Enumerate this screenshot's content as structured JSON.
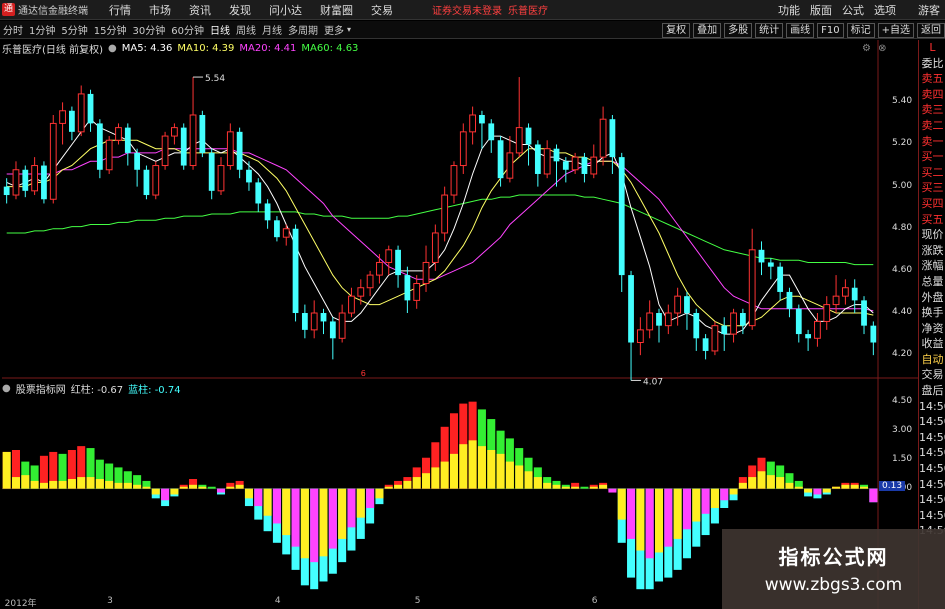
{
  "app": {
    "logo_glyph": "通",
    "title": "通达信金融终端"
  },
  "menu": [
    "行情",
    "市场",
    "资讯",
    "发现",
    "问小达",
    "财富圈",
    "交易"
  ],
  "login_notice": "证券交易未登录",
  "stock_link": "乐普医疗",
  "right_menu": [
    "功能",
    "版面",
    "公式",
    "选项",
    "游客"
  ],
  "periods": [
    "分时",
    "1分钟",
    "5分钟",
    "15分钟",
    "30分钟",
    "60分钟",
    "日线",
    "周线",
    "月线",
    "多周期",
    "更多"
  ],
  "active_period": "日线",
  "toolbar_buttons": [
    "复权",
    "叠加",
    "多股",
    "统计",
    "画线",
    "F10",
    "标记",
    "+自选",
    "返回"
  ],
  "main_legend": {
    "title": "乐普医疗(日线 前复权)",
    "items": [
      {
        "label": "MA5: 4.36",
        "color": "#ffffff"
      },
      {
        "label": "MA10: 4.39",
        "color": "#ffff66"
      },
      {
        "label": "MA20: 4.41",
        "color": "#ff44ff"
      },
      {
        "label": "MA60: 4.63",
        "color": "#44ff44"
      }
    ]
  },
  "sub_legend": {
    "title": "股票指标网",
    "items": [
      {
        "label": "红柱: -0.67",
        "color": "#dddddd"
      },
      {
        "label": "蓝柱: -0.74",
        "color": "#44ffff"
      }
    ]
  },
  "price_labels": [
    "5.40",
    "5.20",
    "5.00",
    "4.80",
    "4.60",
    "4.40",
    "4.20"
  ],
  "indicator_labels": [
    "4.50",
    "3.00",
    "1.50",
    "0.00"
  ],
  "indicator_current": "0.13",
  "annotations": {
    "high": "5.54",
    "low": "4.07",
    "marker": "6"
  },
  "xaxis_labels": [
    {
      "text": "2012年",
      "day": 0
    },
    {
      "text": "3",
      "day": 11
    },
    {
      "text": "4",
      "day": 29
    },
    {
      "text": "5",
      "day": 44
    },
    {
      "text": "6",
      "day": 63
    }
  ],
  "sidebar": [
    {
      "t": "L",
      "c": "red"
    },
    {
      "t": "委比",
      "c": "white"
    },
    {
      "t": "卖五",
      "c": "red"
    },
    {
      "t": "卖四",
      "c": "red"
    },
    {
      "t": "卖三",
      "c": "red"
    },
    {
      "t": "卖二",
      "c": "red"
    },
    {
      "t": "卖一",
      "c": "red"
    },
    {
      "t": "买一",
      "c": "red"
    },
    {
      "t": "买二",
      "c": "red"
    },
    {
      "t": "买三",
      "c": "red"
    },
    {
      "t": "买四",
      "c": "red"
    },
    {
      "t": "买五",
      "c": "red"
    },
    {
      "t": "现价",
      "c": "white"
    },
    {
      "t": "涨跌",
      "c": "white"
    },
    {
      "t": "涨幅",
      "c": "white"
    },
    {
      "t": "总量",
      "c": "white"
    },
    {
      "t": "外盘",
      "c": "white"
    },
    {
      "t": "换手",
      "c": "white"
    },
    {
      "t": "净资",
      "c": "white"
    },
    {
      "t": "收益",
      "c": "white"
    },
    {
      "t": "自动",
      "c": "gold"
    },
    {
      "t": "交易",
      "c": "white"
    },
    {
      "t": "盘后",
      "c": "white"
    },
    {
      "t": "14:50",
      "c": "white"
    },
    {
      "t": "14:50",
      "c": "white"
    },
    {
      "t": "14:50",
      "c": "white"
    },
    {
      "t": "14:50",
      "c": "white"
    },
    {
      "t": "14:50",
      "c": "white"
    },
    {
      "t": "14:50",
      "c": "white"
    },
    {
      "t": "14:50",
      "c": "white"
    },
    {
      "t": "14:50",
      "c": "white"
    },
    {
      "t": "14:50",
      "c": "white"
    }
  ],
  "watermark": {
    "title": "指标公式网",
    "url": "www.zbgs3.com"
  },
  "colors": {
    "up": "#ff3333",
    "down": "#44ffff",
    "ma5": "#ffffff",
    "ma10": "#ffff66",
    "ma20": "#ff44ff",
    "ma60": "#44ff44",
    "bar_red": "#ff2222",
    "bar_green": "#33ee33",
    "bar_yellow": "#ffee22",
    "bar_cyan": "#44ffff",
    "bar_magenta": "#ff44ff"
  },
  "chart_data": {
    "type": "candlestick",
    "symbol": "乐普医疗",
    "ylim": [
      4.12,
      5.62
    ],
    "candles": [
      [
        5.0,
        4.96,
        5.04,
        4.92
      ],
      [
        4.96,
        5.08,
        5.12,
        4.94
      ],
      [
        5.08,
        4.98,
        5.1,
        4.95
      ],
      [
        4.98,
        5.1,
        5.14,
        4.96
      ],
      [
        5.1,
        4.94,
        5.12,
        4.92
      ],
      [
        4.94,
        5.3,
        5.34,
        4.92
      ],
      [
        5.3,
        5.36,
        5.4,
        5.2
      ],
      [
        5.36,
        5.26,
        5.38,
        5.22
      ],
      [
        5.26,
        5.44,
        5.48,
        5.24
      ],
      [
        5.44,
        5.3,
        5.46,
        5.26
      ],
      [
        5.3,
        5.08,
        5.32,
        5.04
      ],
      [
        5.08,
        5.22,
        5.24,
        5.06
      ],
      [
        5.22,
        5.28,
        5.3,
        5.2
      ],
      [
        5.28,
        5.16,
        5.3,
        5.1
      ],
      [
        5.16,
        5.08,
        5.18,
        5.0
      ],
      [
        5.08,
        4.96,
        5.1,
        4.94
      ],
      [
        4.96,
        5.1,
        5.12,
        4.94
      ],
      [
        5.1,
        5.24,
        5.26,
        5.08
      ],
      [
        5.24,
        5.28,
        5.3,
        5.2
      ],
      [
        5.28,
        5.1,
        5.3,
        5.08
      ],
      [
        5.1,
        5.34,
        5.52,
        5.08
      ],
      [
        5.34,
        5.16,
        5.36,
        5.14
      ],
      [
        5.16,
        4.98,
        5.18,
        4.94
      ],
      [
        4.98,
        5.1,
        5.14,
        4.96
      ],
      [
        5.1,
        5.26,
        5.3,
        5.08
      ],
      [
        5.26,
        5.08,
        5.28,
        5.04
      ],
      [
        5.08,
        5.02,
        5.12,
        4.98
      ],
      [
        5.02,
        4.92,
        5.04,
        4.88
      ],
      [
        4.92,
        4.84,
        4.94,
        4.8
      ],
      [
        4.84,
        4.76,
        4.86,
        4.74
      ],
      [
        4.76,
        4.8,
        4.82,
        4.72
      ],
      [
        4.8,
        4.4,
        4.82,
        4.36
      ],
      [
        4.4,
        4.32,
        4.44,
        4.28
      ],
      [
        4.32,
        4.4,
        4.46,
        4.28
      ],
      [
        4.4,
        4.36,
        4.42,
        4.3
      ],
      [
        4.36,
        4.28,
        4.38,
        4.18
      ],
      [
        4.28,
        4.4,
        4.44,
        4.26
      ],
      [
        4.4,
        4.48,
        4.52,
        4.38
      ],
      [
        4.48,
        4.52,
        4.56,
        4.44
      ],
      [
        4.52,
        4.58,
        4.6,
        4.48
      ],
      [
        4.58,
        4.64,
        4.68,
        4.54
      ],
      [
        4.64,
        4.7,
        4.72,
        4.58
      ],
      [
        4.7,
        4.58,
        4.72,
        4.52
      ],
      [
        4.58,
        4.46,
        4.62,
        4.4
      ],
      [
        4.46,
        4.54,
        4.58,
        4.42
      ],
      [
        4.54,
        4.64,
        4.72,
        4.5
      ],
      [
        4.64,
        4.78,
        4.82,
        4.6
      ],
      [
        4.78,
        4.96,
        5.0,
        4.74
      ],
      [
        4.96,
        5.1,
        5.12,
        4.92
      ],
      [
        5.1,
        5.26,
        5.3,
        5.06
      ],
      [
        5.26,
        5.34,
        5.38,
        5.2
      ],
      [
        5.34,
        5.3,
        5.36,
        5.18
      ],
      [
        5.3,
        5.22,
        5.32,
        5.16
      ],
      [
        5.22,
        5.04,
        5.24,
        5.0
      ],
      [
        5.04,
        5.16,
        5.24,
        5.02
      ],
      [
        5.16,
        5.28,
        5.52,
        5.14
      ],
      [
        5.28,
        5.2,
        5.3,
        5.1
      ],
      [
        5.2,
        5.06,
        5.22,
        5.0
      ],
      [
        5.06,
        5.18,
        5.22,
        5.04
      ],
      [
        5.18,
        5.12,
        5.2,
        5.0
      ],
      [
        5.12,
        5.08,
        5.14,
        5.02
      ],
      [
        5.08,
        5.14,
        5.16,
        5.06
      ],
      [
        5.14,
        5.06,
        5.16,
        5.02
      ],
      [
        5.06,
        5.14,
        5.2,
        5.04
      ],
      [
        5.14,
        5.32,
        5.38,
        5.1
      ],
      [
        5.32,
        5.14,
        5.34,
        5.06
      ],
      [
        5.14,
        4.58,
        5.16,
        4.5
      ],
      [
        4.58,
        4.26,
        4.6,
        4.08
      ],
      [
        4.26,
        4.32,
        4.38,
        4.2
      ],
      [
        4.32,
        4.4,
        4.46,
        4.28
      ],
      [
        4.4,
        4.34,
        4.42,
        4.26
      ],
      [
        4.34,
        4.4,
        4.44,
        4.3
      ],
      [
        4.4,
        4.48,
        4.52,
        4.34
      ],
      [
        4.48,
        4.4,
        4.5,
        4.32
      ],
      [
        4.4,
        4.28,
        4.42,
        4.22
      ],
      [
        4.28,
        4.22,
        4.3,
        4.18
      ],
      [
        4.22,
        4.34,
        4.36,
        4.2
      ],
      [
        4.34,
        4.3,
        4.38,
        4.22
      ],
      [
        4.3,
        4.4,
        4.42,
        4.26
      ],
      [
        4.4,
        4.34,
        4.42,
        4.3
      ],
      [
        4.34,
        4.7,
        4.8,
        4.32
      ],
      [
        4.7,
        4.64,
        4.74,
        4.58
      ],
      [
        4.64,
        4.62,
        4.66,
        4.56
      ],
      [
        4.62,
        4.5,
        4.64,
        4.46
      ],
      [
        4.5,
        4.42,
        4.52,
        4.38
      ],
      [
        4.42,
        4.3,
        4.44,
        4.26
      ],
      [
        4.3,
        4.28,
        4.32,
        4.22
      ],
      [
        4.28,
        4.36,
        4.4,
        4.24
      ],
      [
        4.36,
        4.44,
        4.48,
        4.32
      ],
      [
        4.44,
        4.48,
        4.58,
        4.4
      ],
      [
        4.48,
        4.52,
        4.56,
        4.44
      ],
      [
        4.52,
        4.46,
        4.56,
        4.4
      ],
      [
        4.46,
        4.34,
        4.48,
        4.3
      ],
      [
        4.34,
        4.26,
        4.36,
        4.2
      ]
    ],
    "ma5": [
      5.02,
      5.0,
      5.02,
      5.04,
      5.02,
      5.08,
      5.14,
      5.2,
      5.26,
      5.32,
      5.28,
      5.26,
      5.24,
      5.22,
      5.16,
      5.14,
      5.12,
      5.14,
      5.16,
      5.16,
      5.2,
      5.22,
      5.18,
      5.16,
      5.18,
      5.14,
      5.1,
      5.06,
      5.0,
      4.92,
      4.82,
      4.72,
      4.62,
      4.54,
      4.46,
      4.38,
      4.36,
      4.36,
      4.4,
      4.46,
      4.52,
      4.58,
      4.6,
      4.6,
      4.6,
      4.6,
      4.64,
      4.7,
      4.8,
      4.92,
      5.06,
      5.18,
      5.24,
      5.24,
      5.22,
      5.2,
      5.2,
      5.16,
      5.14,
      5.14,
      5.12,
      5.12,
      5.1,
      5.1,
      5.14,
      5.16,
      5.06,
      4.9,
      4.76,
      4.62,
      4.44,
      4.36,
      4.38,
      4.4,
      4.38,
      4.34,
      4.32,
      4.3,
      4.3,
      4.32,
      4.38,
      4.46,
      4.52,
      4.58,
      4.58,
      4.5,
      4.42,
      4.36,
      4.36,
      4.38,
      4.42,
      4.44,
      4.44,
      4.4
    ],
    "ma10": [
      5.0,
      5.0,
      5.0,
      5.02,
      5.02,
      5.04,
      5.08,
      5.1,
      5.14,
      5.18,
      5.2,
      5.22,
      5.22,
      5.22,
      5.22,
      5.2,
      5.18,
      5.18,
      5.18,
      5.16,
      5.16,
      5.16,
      5.16,
      5.16,
      5.16,
      5.16,
      5.14,
      5.12,
      5.08,
      5.04,
      4.98,
      4.9,
      4.82,
      4.74,
      4.66,
      4.58,
      4.52,
      4.48,
      4.46,
      4.44,
      4.44,
      4.46,
      4.48,
      4.5,
      4.52,
      4.54,
      4.56,
      4.6,
      4.66,
      4.72,
      4.8,
      4.9,
      4.98,
      5.04,
      5.1,
      5.14,
      5.18,
      5.18,
      5.18,
      5.16,
      5.16,
      5.14,
      5.14,
      5.12,
      5.12,
      5.12,
      5.08,
      5.02,
      4.94,
      4.86,
      4.78,
      4.68,
      4.58,
      4.5,
      4.44,
      4.4,
      4.36,
      4.34,
      4.34,
      4.34,
      4.36,
      4.38,
      4.42,
      4.46,
      4.48,
      4.48,
      4.46,
      4.44,
      4.42,
      4.4,
      4.4,
      4.4,
      4.4,
      4.39
    ],
    "ma20": [
      5.06,
      5.06,
      5.06,
      5.06,
      5.06,
      5.06,
      5.08,
      5.08,
      5.1,
      5.12,
      5.12,
      5.14,
      5.14,
      5.16,
      5.16,
      5.16,
      5.16,
      5.18,
      5.18,
      5.18,
      5.18,
      5.18,
      5.18,
      5.18,
      5.18,
      5.16,
      5.16,
      5.14,
      5.12,
      5.1,
      5.08,
      5.04,
      5.0,
      4.96,
      4.92,
      4.86,
      4.82,
      4.78,
      4.74,
      4.7,
      4.66,
      4.62,
      4.6,
      4.58,
      4.56,
      4.56,
      4.56,
      4.58,
      4.6,
      4.62,
      4.64,
      4.68,
      4.72,
      4.76,
      4.82,
      4.86,
      4.9,
      4.94,
      4.98,
      5.02,
      5.06,
      5.08,
      5.1,
      5.12,
      5.12,
      5.12,
      5.1,
      5.06,
      5.02,
      4.98,
      4.94,
      4.88,
      4.82,
      4.76,
      4.7,
      4.64,
      4.58,
      4.52,
      4.48,
      4.46,
      4.44,
      4.42,
      4.42,
      4.42,
      4.42,
      4.42,
      4.42,
      4.42,
      4.42,
      4.42,
      4.42,
      4.42,
      4.42,
      4.41
    ],
    "ma60": [
      4.78,
      4.78,
      4.78,
      4.79,
      4.79,
      4.8,
      4.8,
      4.81,
      4.81,
      4.82,
      4.82,
      4.82,
      4.83,
      4.83,
      4.84,
      4.84,
      4.84,
      4.85,
      4.85,
      4.86,
      4.86,
      4.86,
      4.87,
      4.87,
      4.87,
      4.88,
      4.88,
      4.88,
      4.88,
      4.88,
      4.88,
      4.88,
      4.87,
      4.87,
      4.86,
      4.86,
      4.86,
      4.85,
      4.85,
      4.85,
      4.85,
      4.85,
      4.86,
      4.86,
      4.87,
      4.88,
      4.89,
      4.9,
      4.91,
      4.92,
      4.93,
      4.94,
      4.94,
      4.95,
      4.95,
      4.96,
      4.96,
      4.96,
      4.96,
      4.96,
      4.96,
      4.96,
      4.95,
      4.95,
      4.94,
      4.93,
      4.92,
      4.9,
      4.88,
      4.86,
      4.84,
      4.82,
      4.8,
      4.78,
      4.76,
      4.74,
      4.72,
      4.7,
      4.69,
      4.68,
      4.67,
      4.66,
      4.66,
      4.65,
      4.65,
      4.65,
      4.64,
      4.64,
      4.64,
      4.64,
      4.64,
      4.63,
      4.63,
      4.63
    ],
    "indicator": {
      "ylim": [
        -5.5,
        5.0
      ],
      "bars": [
        [
          1.9,
          1.9
        ],
        [
          2.0,
          0.6
        ],
        [
          1.4,
          0.7
        ],
        [
          1.2,
          0.4
        ],
        [
          1.7,
          0.3
        ],
        [
          1.9,
          0.4
        ],
        [
          1.8,
          0.4
        ],
        [
          2.0,
          0.5
        ],
        [
          2.2,
          0.6
        ],
        [
          2.1,
          0.6
        ],
        [
          1.5,
          0.5
        ],
        [
          1.3,
          0.4
        ],
        [
          1.1,
          0.3
        ],
        [
          0.9,
          0.3
        ],
        [
          0.7,
          0.2
        ],
        [
          0.4,
          0.1
        ],
        [
          -0.3,
          -0.5
        ],
        [
          -0.6,
          -0.9
        ],
        [
          -0.3,
          -0.4
        ],
        [
          0.2,
          0.1
        ],
        [
          0.5,
          0.2
        ],
        [
          0.2,
          0.1
        ],
        [
          0.1,
          0.0
        ],
        [
          -0.2,
          -0.3
        ],
        [
          0.3,
          0.1
        ],
        [
          0.4,
          0.2
        ],
        [
          -0.5,
          -0.9
        ],
        [
          -0.9,
          -1.6
        ],
        [
          -1.4,
          -2.2
        ],
        [
          -1.8,
          -2.8
        ],
        [
          -2.4,
          -3.4
        ],
        [
          -3.0,
          -4.2
        ],
        [
          -3.6,
          -5.0
        ],
        [
          -3.8,
          -5.2
        ],
        [
          -3.5,
          -4.8
        ],
        [
          -3.1,
          -4.4
        ],
        [
          -2.6,
          -3.8
        ],
        [
          -2.0,
          -3.2
        ],
        [
          -1.5,
          -2.6
        ],
        [
          -1.0,
          -1.8
        ],
        [
          -0.5,
          -0.8
        ],
        [
          0.2,
          0.1
        ],
        [
          0.4,
          0.2
        ],
        [
          0.6,
          0.4
        ],
        [
          1.1,
          0.6
        ],
        [
          1.6,
          0.8
        ],
        [
          2.4,
          1.1
        ],
        [
          3.2,
          1.4
        ],
        [
          3.9,
          1.8
        ],
        [
          4.4,
          2.3
        ],
        [
          4.5,
          2.5
        ],
        [
          4.1,
          2.2
        ],
        [
          3.6,
          2.0
        ],
        [
          3.0,
          1.8
        ],
        [
          2.6,
          1.4
        ],
        [
          2.1,
          1.2
        ],
        [
          1.6,
          0.9
        ],
        [
          1.1,
          0.6
        ],
        [
          0.6,
          0.3
        ],
        [
          0.4,
          0.2
        ],
        [
          0.2,
          0.1
        ],
        [
          0.3,
          0.1
        ],
        [
          0.1,
          0.0
        ],
        [
          0.2,
          0.1
        ],
        [
          0.3,
          0.2
        ],
        [
          -0.2,
          -0.1
        ],
        [
          -1.6,
          -2.8
        ],
        [
          -2.6,
          -4.6
        ],
        [
          -3.2,
          -5.2
        ],
        [
          -3.6,
          -5.2
        ],
        [
          -3.3,
          -4.8
        ],
        [
          -3.0,
          -4.6
        ],
        [
          -2.6,
          -4.2
        ],
        [
          -2.1,
          -3.6
        ],
        [
          -1.7,
          -3.0
        ],
        [
          -1.3,
          -2.4
        ],
        [
          -1.0,
          -1.8
        ],
        [
          -0.6,
          -1.0
        ],
        [
          -0.3,
          -0.6
        ],
        [
          0.6,
          0.3
        ],
        [
          1.2,
          0.6
        ],
        [
          1.6,
          0.9
        ],
        [
          1.4,
          0.7
        ],
        [
          1.2,
          0.6
        ],
        [
          0.8,
          0.3
        ],
        [
          0.4,
          0.1
        ],
        [
          -0.2,
          -0.4
        ],
        [
          -0.3,
          -0.5
        ],
        [
          -0.2,
          -0.3
        ],
        [
          0.1,
          0.1
        ],
        [
          0.3,
          0.2
        ],
        [
          0.3,
          0.2
        ],
        [
          0.2,
          0.1
        ],
        [
          -0.7,
          -0.7
        ]
      ]
    }
  }
}
